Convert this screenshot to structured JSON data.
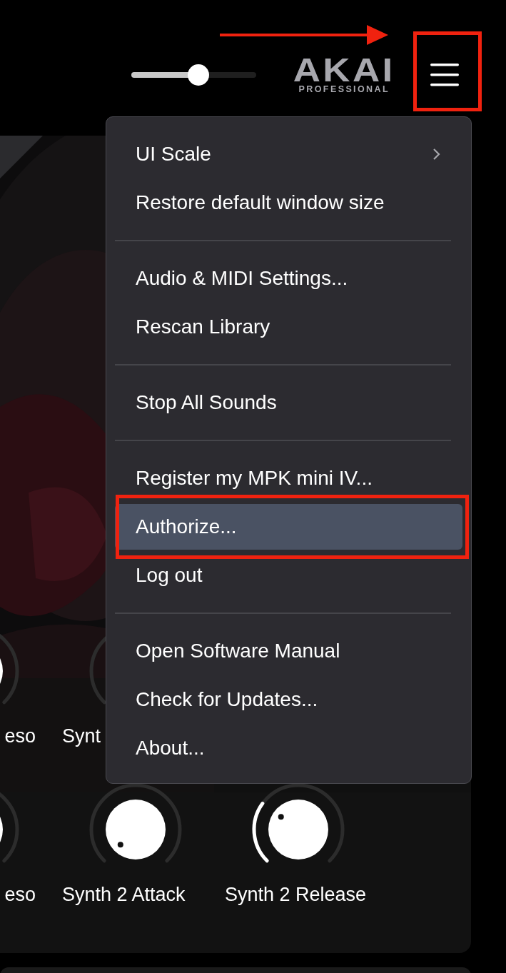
{
  "header": {
    "volume_slider": {
      "level": 0.54
    },
    "logo": {
      "brand": "AKAI",
      "tagline": "PROFESSIONAL"
    }
  },
  "knob_rows": [
    {
      "knobs": [
        {
          "label": "eso"
        },
        {
          "label": "Synt"
        }
      ]
    },
    {
      "knobs": [
        {
          "label": "eso"
        },
        {
          "label": "Synth 2 Attack"
        },
        {
          "label": "Synth 2 Release"
        }
      ]
    }
  ],
  "menu": {
    "sections": [
      {
        "items": [
          {
            "label": "UI Scale",
            "has_submenu": true,
            "selected": false
          },
          {
            "label": "Restore default window size",
            "has_submenu": false,
            "selected": false
          }
        ]
      },
      {
        "items": [
          {
            "label": "Audio & MIDI Settings...",
            "has_submenu": false,
            "selected": false
          },
          {
            "label": "Rescan Library",
            "has_submenu": false,
            "selected": false
          }
        ]
      },
      {
        "items": [
          {
            "label": "Stop All Sounds",
            "has_submenu": false,
            "selected": false
          }
        ]
      },
      {
        "items": [
          {
            "label": "Register my MPK mini IV...",
            "has_submenu": false,
            "selected": false
          },
          {
            "label": "Authorize...",
            "has_submenu": false,
            "selected": true
          },
          {
            "label": "Log out",
            "has_submenu": false,
            "selected": false
          }
        ]
      },
      {
        "items": [
          {
            "label": "Open Software Manual",
            "has_submenu": false,
            "selected": false
          },
          {
            "label": "Check for Updates...",
            "has_submenu": false,
            "selected": false
          },
          {
            "label": "About...",
            "has_submenu": false,
            "selected": false
          }
        ]
      }
    ]
  }
}
